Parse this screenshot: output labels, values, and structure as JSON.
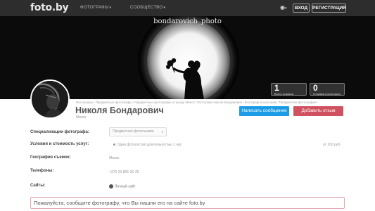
{
  "header": {
    "logo": "foto.by",
    "nav": [
      {
        "label": "ФОТОГРАФЫ"
      },
      {
        "label": "СООБЩЕСТВО"
      }
    ],
    "login": "ВХОД",
    "register": "РЕГИСТРАЦИЯ"
  },
  "cover": {
    "watermark": "bondarovich_photo"
  },
  "stats": [
    {
      "value": "1",
      "label": "Всего отзывов"
    },
    {
      "value": "0",
      "label": "Отзывов в категории"
    }
  ],
  "profile": {
    "breadcrumb": "Фотографы / Предметные фотографы / Предметные фотографы в городе Минск / Фотограф Николя Бондарович / Фотограф в категории \"Предметная фотография\"",
    "name": "Николя Бондарович",
    "city": "Минск",
    "message_button": "Написать сообщение",
    "review_button": "Добавить отзыв"
  },
  "info": {
    "specialization_label": "Специализации фотографа:",
    "specialization_value": "Предметная фотосъемка",
    "terms_label": "Условия и стоимость услуг:",
    "terms_service": "Одна фотосессия длительностью 1 час",
    "terms_price": "от 100 руб.",
    "geography_label": "География съемок:",
    "geography_value": "Минск",
    "phones_label": "Телефоны:",
    "phones_value": "+375 29 865-26-25",
    "sites_label": "Сайты:",
    "sites_value": "Личный сайт"
  },
  "notice": "Пожалуйста, сообщите фотографу, что Вы нашли его на сайте foto.by"
}
